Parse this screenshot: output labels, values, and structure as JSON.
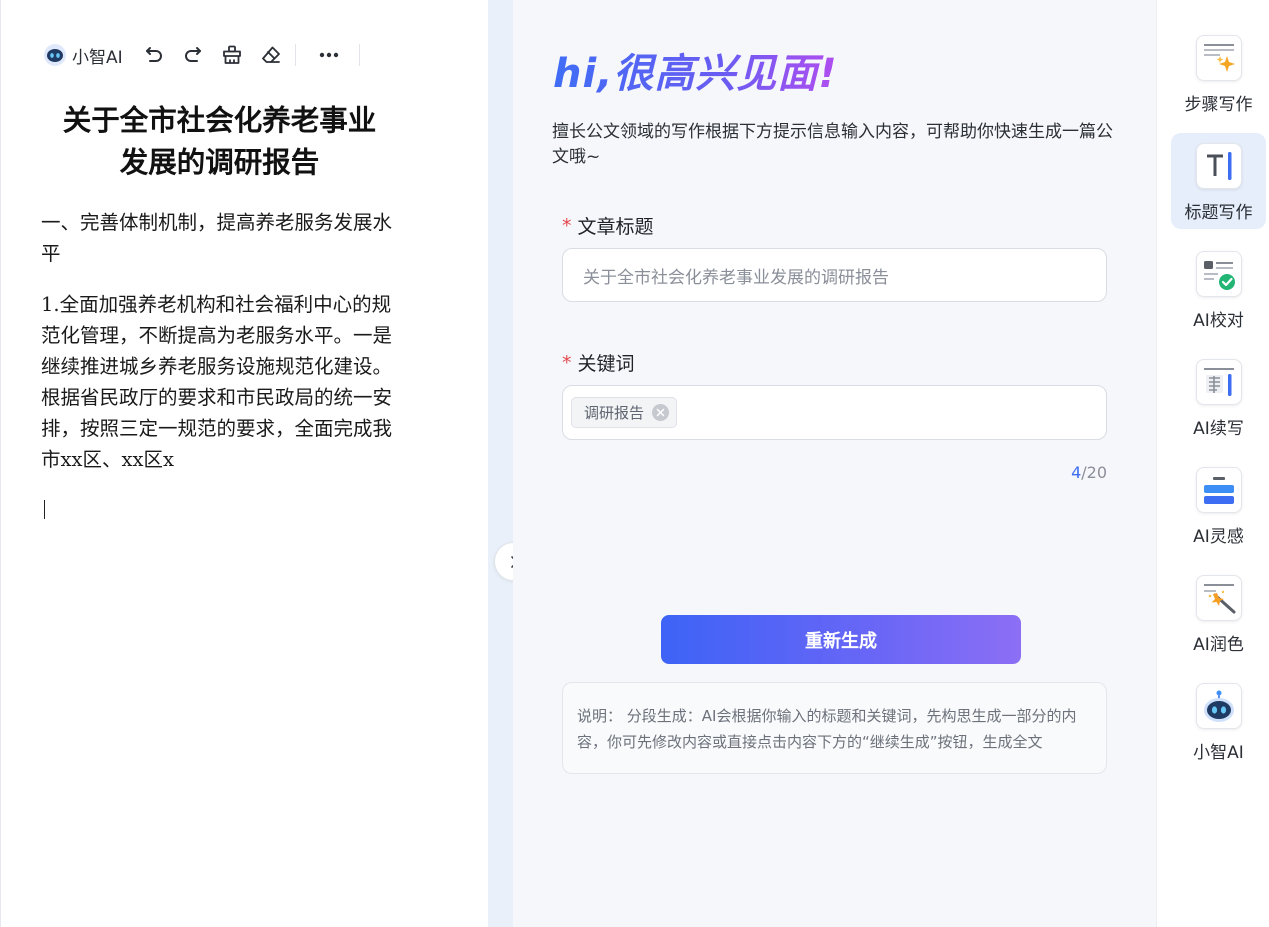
{
  "toolbar": {
    "brand": "小智AI",
    "icons": [
      "undo-icon",
      "redo-icon",
      "format-painter-icon",
      "eraser-icon",
      "more-icon"
    ]
  },
  "document": {
    "title_line1": "关于全市社会化养老事业",
    "title_line2": "发展的调研报告",
    "heading1": "一、完善体制机制，提高养老服务发展水平",
    "paragraph1": "1.全面加强养老机构和社会福利中心的规范化管理，不断提高为老服务水平。一是继续推进城乡养老服务设施规范化建设。根据省民政厅的要求和市民政局的统一安排，按照三定一规范的要求，全面完成我市xx区、xx区x"
  },
  "panel": {
    "greeting_prefix": "hi,",
    "greeting": "很高兴见面!",
    "intro": "擅长公文领域的写作根据下方提示信息输入内容，可帮助你快速生成一篇公文哦~",
    "title_label": "文章标题",
    "title_value": "关于全市社会化养老事业发展的调研报告",
    "keyword_label": "关键词",
    "keywords": [
      "调研报告"
    ],
    "counter_current": "4",
    "counter_max": "/20",
    "regenerate_label": "重新生成",
    "notice_label": "说明：",
    "notice_text": "分段生成：AI会根据你输入的标题和关键词，先构思生成一部分的内容，你可先修改内容或直接点击内容下方的“继续生成”按钮，生成全文"
  },
  "sidebar": {
    "active": "标题写作",
    "items": [
      {
        "label": "步骤写作",
        "icon": "step-writing-icon"
      },
      {
        "label": "标题写作",
        "icon": "title-writing-icon"
      },
      {
        "label": "AI校对",
        "icon": "proofread-icon"
      },
      {
        "label": "AI续写",
        "icon": "continue-writing-icon"
      },
      {
        "label": "AI灵感",
        "icon": "inspiration-icon"
      },
      {
        "label": "AI润色",
        "icon": "polish-icon"
      },
      {
        "label": "小智AI",
        "icon": "robot-icon"
      }
    ]
  },
  "colors": {
    "accent": "#3d6df2",
    "required": "#e5484d",
    "button_gradient_start": "#3d63f6",
    "button_gradient_end": "#8c6ff5",
    "active_tool_bg": "#e6eefb"
  }
}
